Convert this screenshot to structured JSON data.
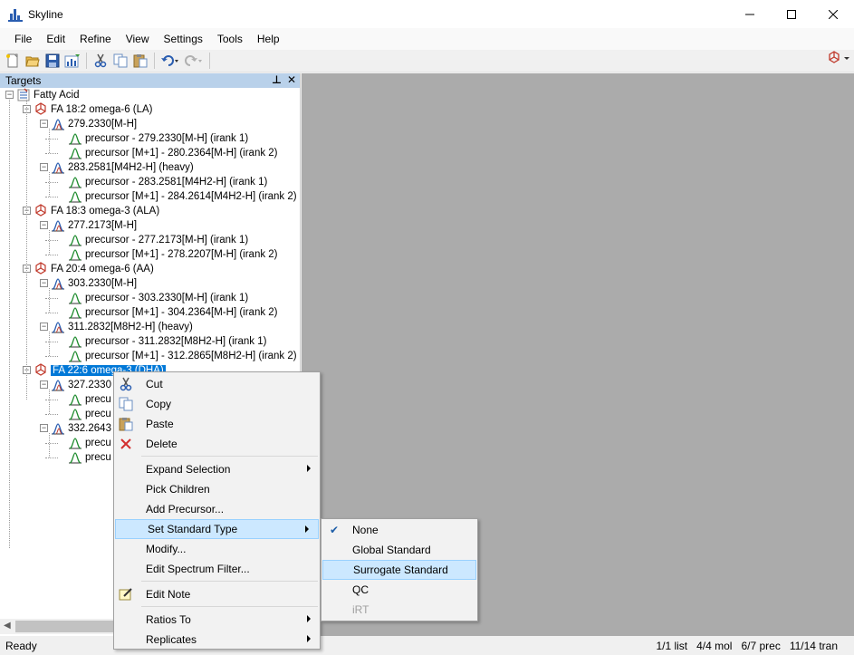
{
  "window": {
    "title": "Skyline"
  },
  "menu": [
    "File",
    "Edit",
    "Refine",
    "View",
    "Settings",
    "Tools",
    "Help"
  ],
  "targets_panel": {
    "title": "Targets",
    "pin_glyph": "📌",
    "close_glyph": "✕"
  },
  "tree": {
    "root": "Fatty Acid",
    "molecules": [
      {
        "label": "FA 18:2 omega-6 (LA)",
        "precursors": [
          {
            "label": "279.2330[M-H]",
            "transitions": [
              "precursor - 279.2330[M-H] (irank 1)",
              "precursor [M+1] - 280.2364[M-H] (irank 2)"
            ]
          },
          {
            "label": "283.2581[M4H2-H] (heavy)",
            "transitions": [
              "precursor - 283.2581[M4H2-H] (irank 1)",
              "precursor [M+1] - 284.2614[M4H2-H] (irank 2)"
            ]
          }
        ]
      },
      {
        "label": "FA 18:3 omega-3 (ALA)",
        "precursors": [
          {
            "label": "277.2173[M-H]",
            "transitions": [
              "precursor - 277.2173[M-H] (irank 1)",
              "precursor [M+1] - 278.2207[M-H] (irank 2)"
            ]
          }
        ]
      },
      {
        "label": "FA 20:4 omega-6 (AA)",
        "precursors": [
          {
            "label": "303.2330[M-H]",
            "transitions": [
              "precursor - 303.2330[M-H] (irank 1)",
              "precursor [M+1] - 304.2364[M-H] (irank 2)"
            ]
          },
          {
            "label": "311.2832[M8H2-H] (heavy)",
            "transitions": [
              "precursor - 311.2832[M8H2-H] (irank 1)",
              "precursor [M+1] - 312.2865[M8H2-H] (irank 2)"
            ]
          }
        ]
      },
      {
        "label": "FA 22:6 omega-3 (DHA)",
        "selected": true,
        "precursors": [
          {
            "label": "327.2330",
            "transitions": [
              "precu",
              "precu"
            ]
          },
          {
            "label": "332.2643",
            "transitions": [
              "precu",
              "precu"
            ]
          }
        ]
      }
    ]
  },
  "context_menu": {
    "items": [
      {
        "label": "Cut",
        "icon": "scissors-icon"
      },
      {
        "label": "Copy",
        "icon": "copy-icon"
      },
      {
        "label": "Paste",
        "icon": "paste-icon"
      },
      {
        "label": "Delete",
        "icon": "delete-icon"
      },
      {
        "sep": true
      },
      {
        "label": "Expand Selection",
        "submenu": true
      },
      {
        "label": "Pick Children"
      },
      {
        "label": "Add Precursor..."
      },
      {
        "label": "Set Standard Type",
        "submenu": true,
        "highlighted": true
      },
      {
        "label": "Modify..."
      },
      {
        "label": "Edit Spectrum Filter..."
      },
      {
        "sep": true
      },
      {
        "label": "Edit Note",
        "icon": "note-icon"
      },
      {
        "sep": true
      },
      {
        "label": "Ratios To",
        "submenu": true
      },
      {
        "label": "Replicates",
        "submenu": true
      }
    ]
  },
  "standard_type_submenu": {
    "items": [
      {
        "label": "None",
        "checked": true
      },
      {
        "label": "Global Standard"
      },
      {
        "label": "Surrogate Standard",
        "highlighted": true
      },
      {
        "label": "QC"
      },
      {
        "label": "iRT",
        "disabled": true
      }
    ]
  },
  "status": {
    "ready": "Ready",
    "lists": "1/1 list",
    "molecules": "4/4 mol",
    "precursors": "6/7 prec",
    "transitions": "11/14 tran"
  },
  "colors": {
    "selection": "#0078d7",
    "menu_highlight": "#cce8ff",
    "panel_header": "#b9d1ea",
    "doc_area": "#ababab"
  }
}
